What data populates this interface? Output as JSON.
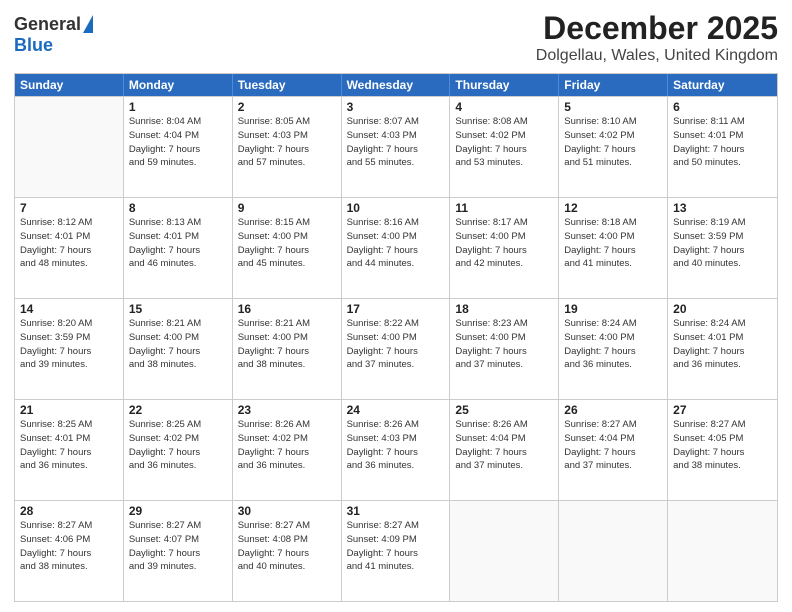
{
  "logo": {
    "general": "General",
    "blue": "Blue"
  },
  "title": "December 2025",
  "subtitle": "Dolgellau, Wales, United Kingdom",
  "header_days": [
    "Sunday",
    "Monday",
    "Tuesday",
    "Wednesday",
    "Thursday",
    "Friday",
    "Saturday"
  ],
  "weeks": [
    [
      {
        "day": "",
        "info": ""
      },
      {
        "day": "1",
        "info": "Sunrise: 8:04 AM\nSunset: 4:04 PM\nDaylight: 7 hours\nand 59 minutes."
      },
      {
        "day": "2",
        "info": "Sunrise: 8:05 AM\nSunset: 4:03 PM\nDaylight: 7 hours\nand 57 minutes."
      },
      {
        "day": "3",
        "info": "Sunrise: 8:07 AM\nSunset: 4:03 PM\nDaylight: 7 hours\nand 55 minutes."
      },
      {
        "day": "4",
        "info": "Sunrise: 8:08 AM\nSunset: 4:02 PM\nDaylight: 7 hours\nand 53 minutes."
      },
      {
        "day": "5",
        "info": "Sunrise: 8:10 AM\nSunset: 4:02 PM\nDaylight: 7 hours\nand 51 minutes."
      },
      {
        "day": "6",
        "info": "Sunrise: 8:11 AM\nSunset: 4:01 PM\nDaylight: 7 hours\nand 50 minutes."
      }
    ],
    [
      {
        "day": "7",
        "info": "Sunrise: 8:12 AM\nSunset: 4:01 PM\nDaylight: 7 hours\nand 48 minutes."
      },
      {
        "day": "8",
        "info": "Sunrise: 8:13 AM\nSunset: 4:01 PM\nDaylight: 7 hours\nand 46 minutes."
      },
      {
        "day": "9",
        "info": "Sunrise: 8:15 AM\nSunset: 4:00 PM\nDaylight: 7 hours\nand 45 minutes."
      },
      {
        "day": "10",
        "info": "Sunrise: 8:16 AM\nSunset: 4:00 PM\nDaylight: 7 hours\nand 44 minutes."
      },
      {
        "day": "11",
        "info": "Sunrise: 8:17 AM\nSunset: 4:00 PM\nDaylight: 7 hours\nand 42 minutes."
      },
      {
        "day": "12",
        "info": "Sunrise: 8:18 AM\nSunset: 4:00 PM\nDaylight: 7 hours\nand 41 minutes."
      },
      {
        "day": "13",
        "info": "Sunrise: 8:19 AM\nSunset: 3:59 PM\nDaylight: 7 hours\nand 40 minutes."
      }
    ],
    [
      {
        "day": "14",
        "info": "Sunrise: 8:20 AM\nSunset: 3:59 PM\nDaylight: 7 hours\nand 39 minutes."
      },
      {
        "day": "15",
        "info": "Sunrise: 8:21 AM\nSunset: 4:00 PM\nDaylight: 7 hours\nand 38 minutes."
      },
      {
        "day": "16",
        "info": "Sunrise: 8:21 AM\nSunset: 4:00 PM\nDaylight: 7 hours\nand 38 minutes."
      },
      {
        "day": "17",
        "info": "Sunrise: 8:22 AM\nSunset: 4:00 PM\nDaylight: 7 hours\nand 37 minutes."
      },
      {
        "day": "18",
        "info": "Sunrise: 8:23 AM\nSunset: 4:00 PM\nDaylight: 7 hours\nand 37 minutes."
      },
      {
        "day": "19",
        "info": "Sunrise: 8:24 AM\nSunset: 4:00 PM\nDaylight: 7 hours\nand 36 minutes."
      },
      {
        "day": "20",
        "info": "Sunrise: 8:24 AM\nSunset: 4:01 PM\nDaylight: 7 hours\nand 36 minutes."
      }
    ],
    [
      {
        "day": "21",
        "info": "Sunrise: 8:25 AM\nSunset: 4:01 PM\nDaylight: 7 hours\nand 36 minutes."
      },
      {
        "day": "22",
        "info": "Sunrise: 8:25 AM\nSunset: 4:02 PM\nDaylight: 7 hours\nand 36 minutes."
      },
      {
        "day": "23",
        "info": "Sunrise: 8:26 AM\nSunset: 4:02 PM\nDaylight: 7 hours\nand 36 minutes."
      },
      {
        "day": "24",
        "info": "Sunrise: 8:26 AM\nSunset: 4:03 PM\nDaylight: 7 hours\nand 36 minutes."
      },
      {
        "day": "25",
        "info": "Sunrise: 8:26 AM\nSunset: 4:04 PM\nDaylight: 7 hours\nand 37 minutes."
      },
      {
        "day": "26",
        "info": "Sunrise: 8:27 AM\nSunset: 4:04 PM\nDaylight: 7 hours\nand 37 minutes."
      },
      {
        "day": "27",
        "info": "Sunrise: 8:27 AM\nSunset: 4:05 PM\nDaylight: 7 hours\nand 38 minutes."
      }
    ],
    [
      {
        "day": "28",
        "info": "Sunrise: 8:27 AM\nSunset: 4:06 PM\nDaylight: 7 hours\nand 38 minutes."
      },
      {
        "day": "29",
        "info": "Sunrise: 8:27 AM\nSunset: 4:07 PM\nDaylight: 7 hours\nand 39 minutes."
      },
      {
        "day": "30",
        "info": "Sunrise: 8:27 AM\nSunset: 4:08 PM\nDaylight: 7 hours\nand 40 minutes."
      },
      {
        "day": "31",
        "info": "Sunrise: 8:27 AM\nSunset: 4:09 PM\nDaylight: 7 hours\nand 41 minutes."
      },
      {
        "day": "",
        "info": ""
      },
      {
        "day": "",
        "info": ""
      },
      {
        "day": "",
        "info": ""
      }
    ]
  ]
}
